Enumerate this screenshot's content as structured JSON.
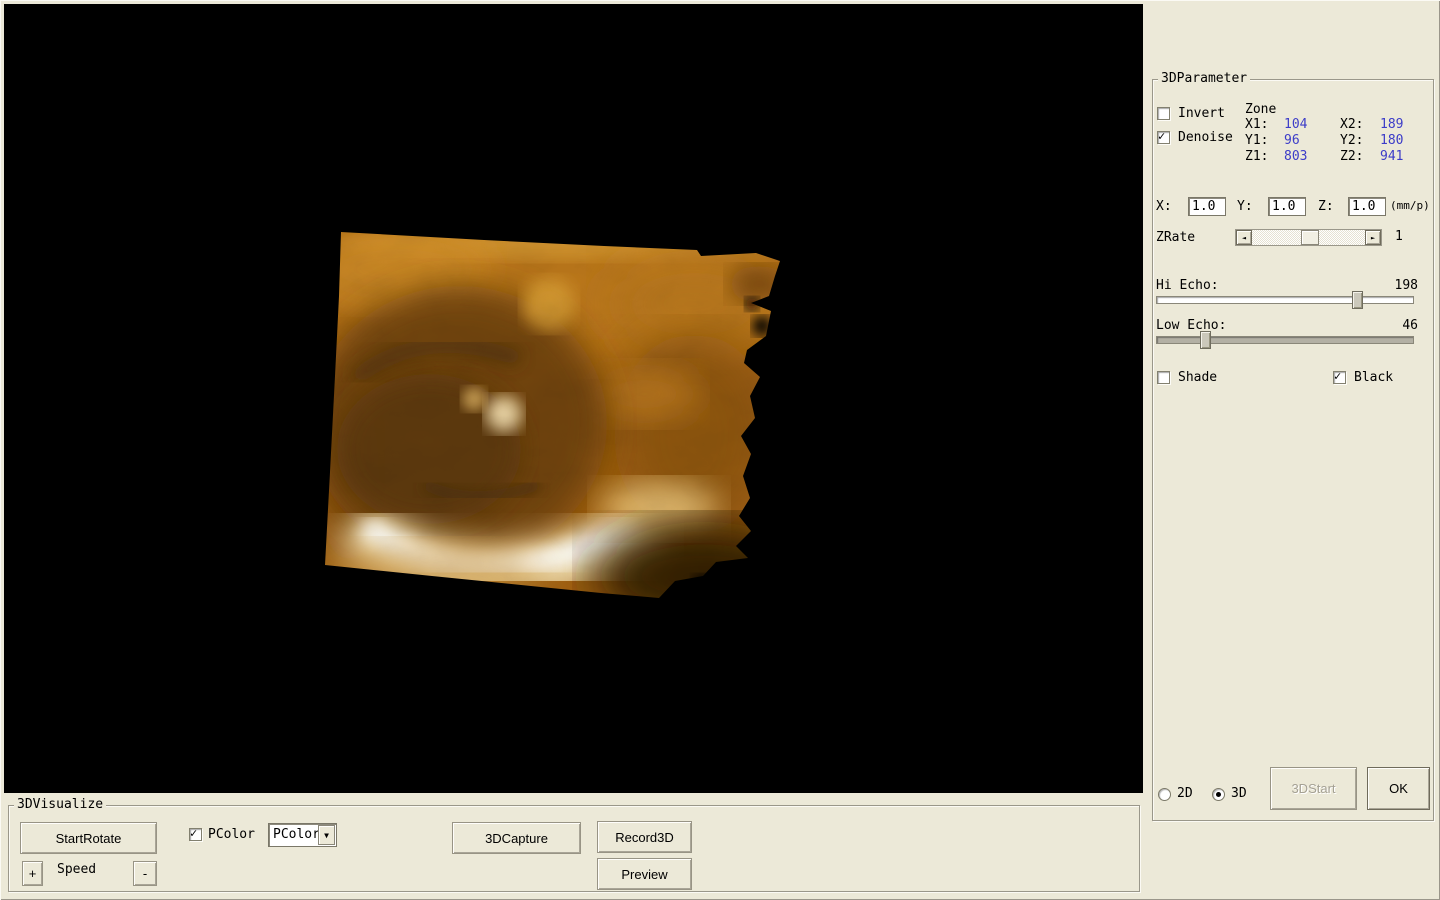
{
  "glyphs": {
    "check": "✓",
    "dropdown_arrow": "▼",
    "scroll_left": "◄",
    "scroll_right": "►"
  },
  "colors": {
    "window_bg": "#ece9d8",
    "viewport_bg": "#000000",
    "zone_value_color": "#3c3cc8",
    "render_base": "#a36110",
    "render_highlight": "#fffef8"
  },
  "parameter_panel": {
    "title": "3DParameter",
    "invert": {
      "label": "Invert",
      "checked": false
    },
    "denoise": {
      "label": "Denoise",
      "checked": true
    },
    "zone": {
      "title": "Zone",
      "rows": [
        {
          "l1": "X1:",
          "v1": "104",
          "l2": "X2:",
          "v2": "189"
        },
        {
          "l1": "Y1:",
          "v1": "96",
          "l2": "Y2:",
          "v2": "180"
        },
        {
          "l1": "Z1:",
          "v1": "803",
          "l2": "Z2:",
          "v2": "941"
        }
      ]
    },
    "scale": {
      "x_label": "X:",
      "x_value": "1.0",
      "y_label": "Y:",
      "y_value": "1.0",
      "z_label": "Z:",
      "z_value": "1.0",
      "unit": "(mm/p)"
    },
    "zrate": {
      "label": "ZRate",
      "value": "1"
    },
    "hi_echo": {
      "label": "Hi Echo:",
      "value": "198",
      "min": 0,
      "max": 255
    },
    "low_echo": {
      "label": "Low Echo:",
      "value": "46",
      "min": 0,
      "max": 255
    },
    "shade": {
      "label": "Shade",
      "checked": false
    },
    "black": {
      "label": "Black",
      "checked": true
    },
    "mode": {
      "label_2d": "2D",
      "label_3d": "3D",
      "selected": "3D"
    },
    "start_button": {
      "label": "3DStart",
      "disabled": true
    },
    "ok_button": {
      "label": "OK",
      "disabled": false
    }
  },
  "visualize_panel": {
    "title": "3DVisualize",
    "start_rotate_button": "StartRotate",
    "pcolor": {
      "label": "PColor",
      "checked": true
    },
    "pcolor_combo": {
      "value": "PColor"
    },
    "speed": {
      "plus": "+",
      "label": "Speed",
      "minus": "-"
    },
    "capture_button": "3DCapture",
    "record_button": "Record3D",
    "preview_button": "Preview"
  }
}
